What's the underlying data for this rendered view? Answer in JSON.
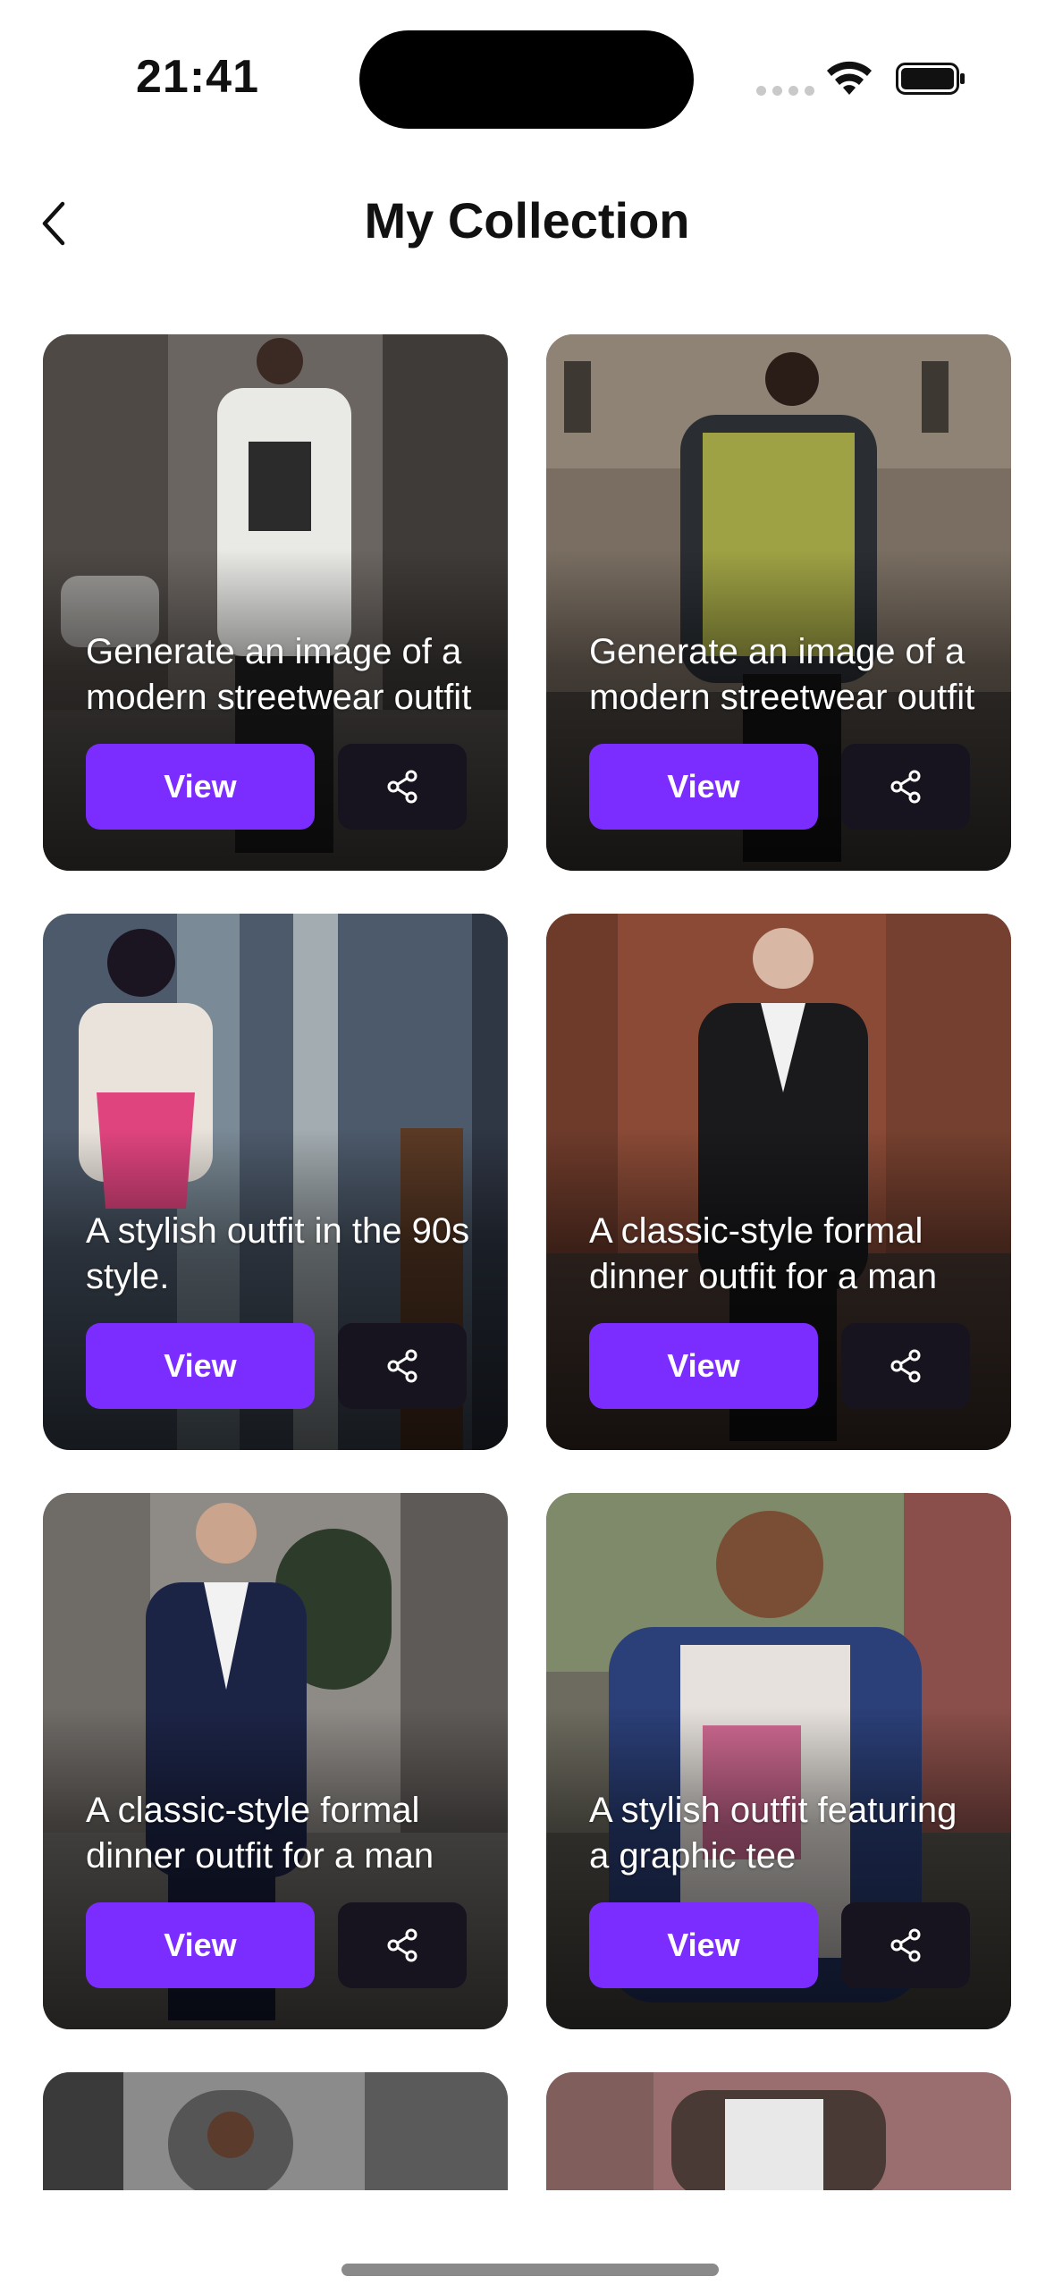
{
  "status_bar": {
    "time": "21:41"
  },
  "header": {
    "title": "My Collection",
    "back_icon": "chevron-left-icon"
  },
  "cards": [
    {
      "caption": "Generate an image of a modern streetwear outfit",
      "view_label": "View",
      "share_icon": "share-icon",
      "palette": [
        "#6b6561",
        "#3a3633",
        "#e9e9e6"
      ]
    },
    {
      "caption": "Generate an image of a modern streetwear outfit",
      "view_label": "View",
      "share_icon": "share-icon",
      "palette": [
        "#7a6e62",
        "#2e2a27",
        "#c7c94b"
      ]
    },
    {
      "caption": "A stylish outfit in the 90s style.",
      "view_label": "View",
      "share_icon": "share-icon",
      "palette": [
        "#4d5a6b",
        "#2f3644",
        "#e0447f"
      ]
    },
    {
      "caption": "A classic-style formal dinner outfit for a man",
      "view_label": "View",
      "share_icon": "share-icon",
      "palette": [
        "#8a4a36",
        "#3b2a22",
        "#1a1a1d"
      ]
    },
    {
      "caption": "A classic-style formal dinner outfit for a man",
      "view_label": "View",
      "share_icon": "share-icon",
      "palette": [
        "#8e8a86",
        "#4b4744",
        "#1c2446"
      ]
    },
    {
      "caption": "A stylish outfit featuring a graphic tee",
      "view_label": "View",
      "share_icon": "share-icon",
      "palette": [
        "#6d6b5f",
        "#2f3145",
        "#2b3f78"
      ]
    },
    {
      "caption": "",
      "palette": [
        "#8b8b8b",
        "#3a3a3a",
        "#555555"
      ]
    },
    {
      "caption": "",
      "palette": [
        "#9a6e6e",
        "#4a3a36",
        "#e8e8e8"
      ]
    }
  ],
  "colors": {
    "accent": "#7b2cff",
    "share_bg": "#17141f"
  }
}
